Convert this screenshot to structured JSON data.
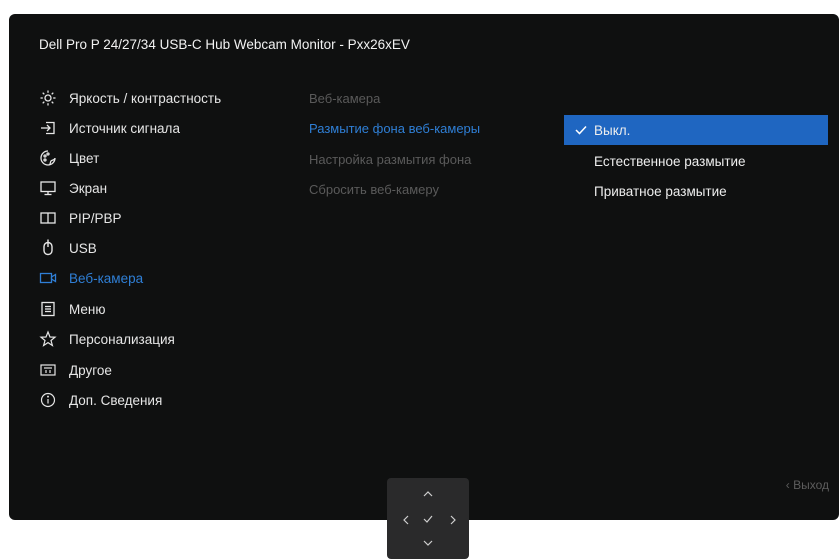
{
  "title": "Dell Pro P 24/27/34 USB-C Hub Webcam Monitor - Pxx26xEV",
  "main_menu": [
    {
      "label": "Яркость / контрастность",
      "icon": "brightness-icon"
    },
    {
      "label": "Источник сигнала",
      "icon": "input-source-icon"
    },
    {
      "label": "Цвет",
      "icon": "color-icon"
    },
    {
      "label": "Экран",
      "icon": "display-icon"
    },
    {
      "label": "PIP/PBP",
      "icon": "pip-pbp-icon"
    },
    {
      "label": "USB",
      "icon": "usb-mouse-icon"
    },
    {
      "label": "Веб-камера",
      "icon": "webcam-icon",
      "active": true
    },
    {
      "label": "Меню",
      "icon": "menu-icon"
    },
    {
      "label": "Персонализация",
      "icon": "star-icon"
    },
    {
      "label": "Другое",
      "icon": "others-icon"
    },
    {
      "label": "Доп. Сведения",
      "icon": "info-icon"
    }
  ],
  "submenu": [
    {
      "label": "Веб-камера",
      "state": "header"
    },
    {
      "label": "Размытие фона веб-камеры",
      "state": "active"
    },
    {
      "label": "Настройка размытия фона",
      "state": "disabled"
    },
    {
      "label": "Сбросить веб-камеру",
      "state": "disabled"
    }
  ],
  "options": [
    {
      "label": "Выкл.",
      "selected": true
    },
    {
      "label": "Естественное размытие",
      "selected": false
    },
    {
      "label": "Приватное размытие",
      "selected": false
    }
  ],
  "exit_label": "‹ Выход",
  "colors": {
    "accent": "#2f7fd6",
    "selection": "#1f66c1",
    "panel": "#0f1010"
  }
}
